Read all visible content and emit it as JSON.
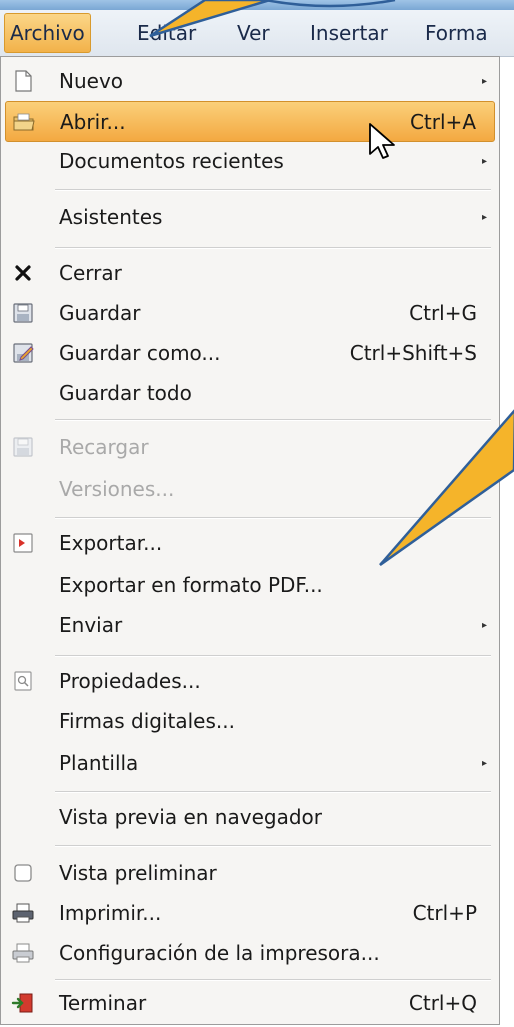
{
  "menubar": {
    "items": [
      {
        "label": "Archivo",
        "active": true
      },
      {
        "label": "Editar"
      },
      {
        "label": "Ver"
      },
      {
        "label": "Insertar"
      },
      {
        "label": "Forma"
      }
    ]
  },
  "menu": {
    "items": [
      {
        "label": "Nuevo",
        "icon": "new-document-icon",
        "submenu": true
      },
      {
        "label": "Abrir...",
        "shortcut": "Ctrl+A",
        "icon": "open-folder-icon",
        "highlighted": true
      },
      {
        "label": "Documentos recientes",
        "submenu": true
      },
      {
        "label": "Asistentes",
        "submenu": true
      },
      {
        "label": "Cerrar",
        "icon": "close-icon"
      },
      {
        "label": "Guardar",
        "shortcut": "Ctrl+G",
        "icon": "save-icon"
      },
      {
        "label": "Guardar como...",
        "shortcut": "Ctrl+Shift+S",
        "icon": "save-as-icon"
      },
      {
        "label": "Guardar todo"
      },
      {
        "label": "Recargar",
        "icon": "reload-icon",
        "disabled": true
      },
      {
        "label": "Versiones...",
        "disabled": true
      },
      {
        "label": "Exportar...",
        "icon": "export-icon"
      },
      {
        "label": "Exportar en formato PDF..."
      },
      {
        "label": "Enviar",
        "submenu": true
      },
      {
        "label": "Propiedades...",
        "icon": "properties-icon"
      },
      {
        "label": "Firmas digitales..."
      },
      {
        "label": "Plantilla",
        "submenu": true
      },
      {
        "label": "Vista previa en navegador"
      },
      {
        "label": "Vista preliminar",
        "icon": "checkbox-icon"
      },
      {
        "label": "Imprimir...",
        "shortcut": "Ctrl+P",
        "icon": "printer-icon"
      },
      {
        "label": "Configuración de la impresora...",
        "icon": "printer-settings-icon"
      },
      {
        "label": "Terminar",
        "shortcut": "Ctrl+Q",
        "icon": "exit-icon"
      }
    ]
  },
  "colors": {
    "highlight": "#f3a941",
    "callout_fill": "#f5b42a",
    "callout_stroke": "#2f5f99"
  }
}
